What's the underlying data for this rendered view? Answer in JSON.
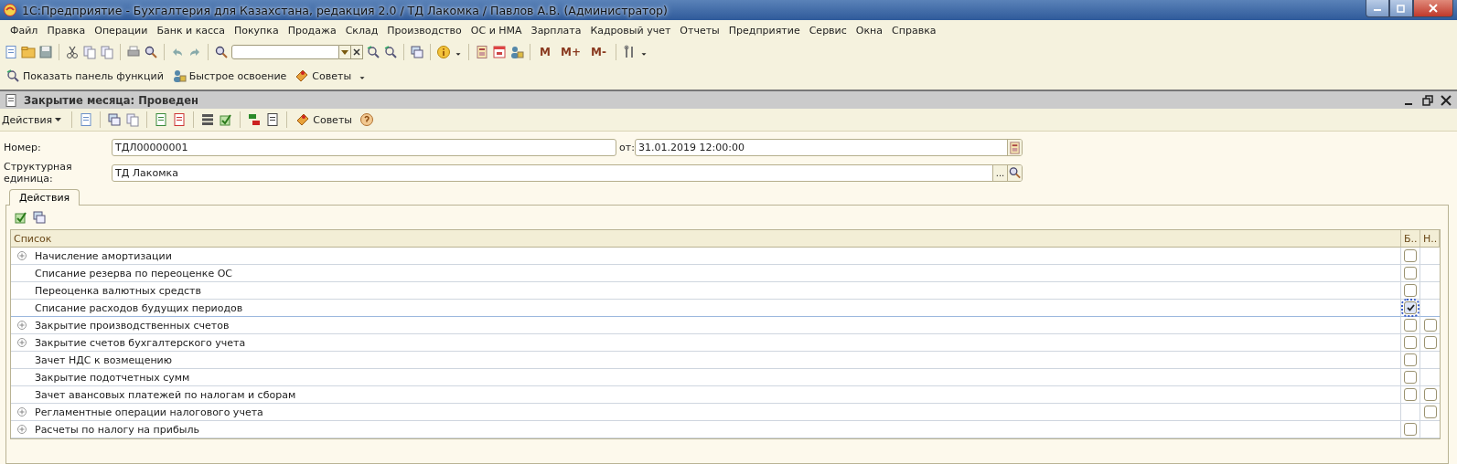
{
  "window": {
    "title": "1С:Предприятие - Бухгалтерия для Казахстана, редакция 2.0 / ТД Лакомка / Павлов А.В. (Администратор)"
  },
  "menu": [
    "Файл",
    "Правка",
    "Операции",
    "Банк и касса",
    "Покупка",
    "Продажа",
    "Склад",
    "Производство",
    "ОС и НМА",
    "Зарплата",
    "Кадровый учет",
    "Отчеты",
    "Предприятие",
    "Сервис",
    "Окна",
    "Справка"
  ],
  "toolbar": {
    "memory_buttons": [
      "M",
      "M+",
      "M-"
    ]
  },
  "panel_bar": [
    "Показать панель функций",
    "Быстрое освоение",
    "Советы"
  ],
  "document": {
    "title": "Закрытие месяца: Проведен",
    "toolbar": {
      "actions": "Действия",
      "tips": "Советы"
    },
    "number_label": "Номер:",
    "number": "ТДЛ00000001",
    "date_label": "от:",
    "date": "31.01.2019 12:00:00",
    "unit_label": "Структурная единица:",
    "unit": "ТД Лакомка",
    "unit_more": "...",
    "tabs": [
      {
        "label": "Действия",
        "selected": true
      }
    ],
    "table": {
      "columns": [
        "Список",
        "Б..",
        "Н.."
      ],
      "rows": [
        {
          "name": "Начисление амортизации",
          "expandable": true,
          "selected": false,
          "b": {
            "checked": false
          }
        },
        {
          "name": "Списание резерва по переоценке ОС",
          "expandable": false,
          "selected": false,
          "b": {
            "checked": false
          }
        },
        {
          "name": "Переоценка валютных средств",
          "expandable": false,
          "selected": false,
          "b": {
            "checked": false
          }
        },
        {
          "name": "Списание расходов будущих периодов",
          "expandable": false,
          "selected": true,
          "b": {
            "checked": true
          }
        },
        {
          "name": "Закрытие производственных счетов",
          "expandable": true,
          "selected": false,
          "b": {
            "checked": false
          },
          "n": {
            "checked": false
          }
        },
        {
          "name": "Закрытие счетов бухгалтерского учета",
          "expandable": true,
          "selected": false,
          "b": {
            "checked": false
          },
          "n": {
            "checked": false
          }
        },
        {
          "name": "Зачет НДС к возмещению",
          "expandable": false,
          "selected": false,
          "b": {
            "checked": false
          }
        },
        {
          "name": "Закрытие подотчетных сумм",
          "expandable": false,
          "selected": false,
          "b": {
            "checked": false
          }
        },
        {
          "name": "Зачет авансовых платежей по налогам и сборам",
          "expandable": false,
          "selected": false,
          "b": {
            "checked": false
          },
          "n": {
            "checked": false
          }
        },
        {
          "name": "Регламентные операции налогового учета",
          "expandable": true,
          "selected": false,
          "n": {
            "checked": false
          }
        },
        {
          "name": "Расчеты по налогу на прибыль",
          "expandable": true,
          "selected": false,
          "b": {
            "checked": false
          }
        }
      ]
    }
  }
}
